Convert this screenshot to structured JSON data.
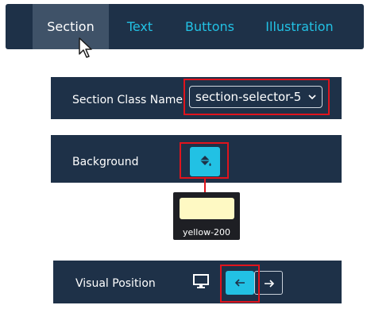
{
  "tabs": [
    {
      "label": "Section",
      "active": true
    },
    {
      "label": "Text",
      "active": false
    },
    {
      "label": "Buttons",
      "active": false
    },
    {
      "label": "Illustration",
      "active": false
    }
  ],
  "section_class": {
    "label": "Section Class Name",
    "value": "section-selector-5"
  },
  "background": {
    "label": "Background",
    "swatch_name": "yellow-200",
    "swatch_color": "#fef9c3",
    "button_icon": "paint-bucket-icon"
  },
  "visual_position": {
    "label": "Visual Position",
    "icons": [
      "monitor-icon",
      "arrow-left-icon",
      "arrow-right-icon"
    ],
    "selected": "left"
  },
  "colors": {
    "panel_bg": "#1e3148",
    "accent": "#22c1e4",
    "highlight": "#e0141d"
  }
}
